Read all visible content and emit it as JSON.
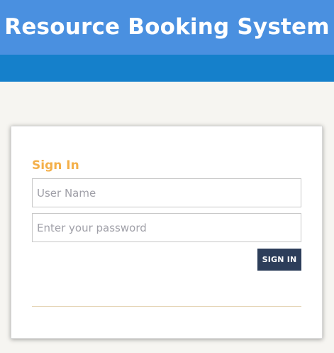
{
  "header": {
    "title": "Resource Booking System"
  },
  "login": {
    "heading": "Sign In",
    "username_placeholder": "User Name",
    "password_placeholder": "Enter your password",
    "submit_label": "SIGN IN"
  },
  "colors": {
    "header_bg": "#4a90e0",
    "subbar_bg": "#1580cb",
    "heading_accent": "#f4b04a",
    "button_bg": "#2d3e5a",
    "page_bg": "#f6f5f1"
  }
}
